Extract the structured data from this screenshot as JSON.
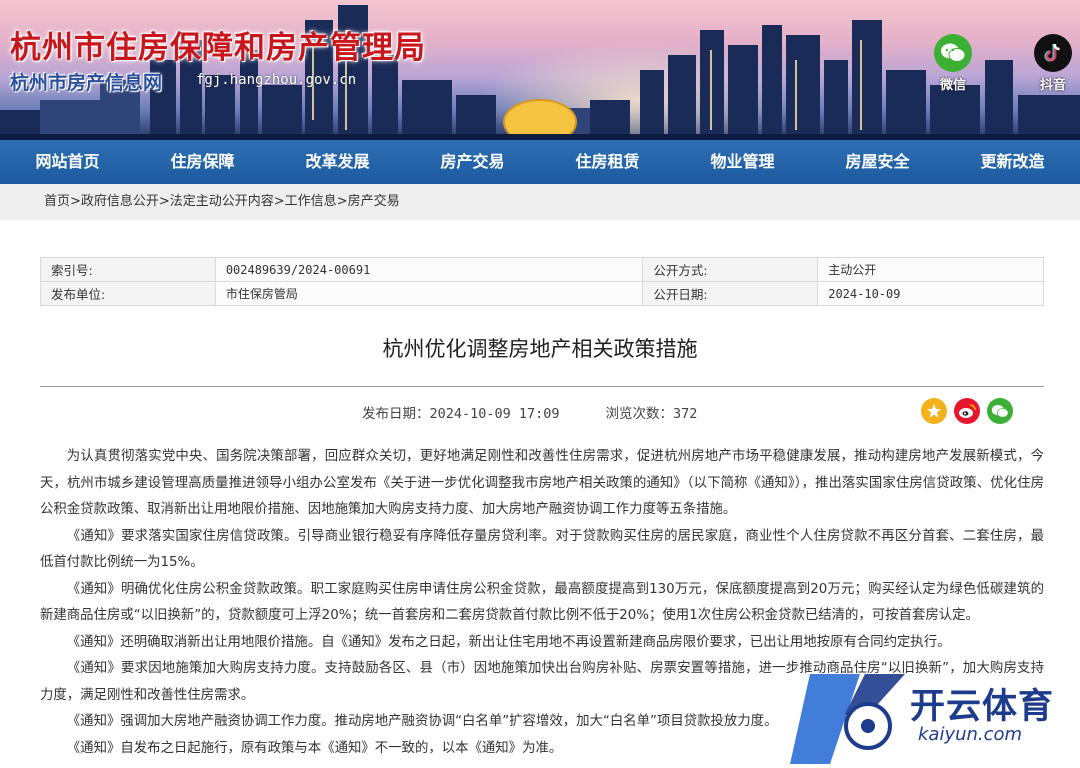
{
  "header": {
    "site_title": "杭州市住房保障和房产管理局",
    "sub_title": "杭州市房产信息网",
    "domain": "fgj.hangzhou.gov.cn",
    "wechat_label": "微信",
    "douyin_label": "抖音"
  },
  "nav": {
    "items": [
      "网站首页",
      "住房保障",
      "改革发展",
      "房产交易",
      "住房租赁",
      "物业管理",
      "房屋安全",
      "更新改造"
    ]
  },
  "breadcrumb": "首页>政府信息公开>法定主动公开内容>工作信息>房产交易",
  "info": {
    "index_label": "索引号:",
    "index_value": "002489639/2024-00691",
    "mode_label": "公开方式:",
    "mode_value": "主动公开",
    "issuer_label": "发布单位:",
    "issuer_value": "市住保房管局",
    "date_label": "公开日期:",
    "date_value": "2024-10-09"
  },
  "article": {
    "title": "杭州优化调整房地产相关政策措施",
    "publish_label": "发布日期：",
    "publish_value": "2024-10-09 17:09",
    "views_label": "浏览次数：",
    "views_value": "372",
    "paragraphs": [
      "为认真贯彻落实党中央、国务院决策部署，回应群众关切，更好地满足刚性和改善性住房需求，促进杭州房地产市场平稳健康发展，推动构建房地产发展新模式，今天，杭州市城乡建设管理高质量推进领导小组办公室发布《关于进一步优化调整我市房地产相关政策的通知》（以下简称《通知》），推出落实国家住房信贷政策、优化住房公积金贷款政策、取消新出让用地限价措施、因地施策加大购房支持力度、加大房地产融资协调工作力度等五条措施。",
      "《通知》要求落实国家住房信贷政策。引导商业银行稳妥有序降低存量房贷利率。对于贷款购买住房的居民家庭，商业性个人住房贷款不再区分首套、二套住房，最低首付款比例统一为15%。",
      "《通知》明确优化住房公积金贷款政策。职工家庭购买住房申请住房公积金贷款，最高额度提高到130万元，保底额度提高到20万元；购买经认定为绿色低碳建筑的新建商品住房或“以旧换新”的，贷款额度可上浮20%；统一首套房和二套房贷款首付款比例不低于20%；使用1次住房公积金贷款已结清的，可按首套房认定。",
      "《通知》还明确取消新出让用地限价措施。自《通知》发布之日起，新出让住宅用地不再设置新建商品房限价要求，已出让用地按原有合同约定执行。",
      "《通知》要求因地施策加大购房支持力度。支持鼓励各区、县（市）因地施策加快出台购房补贴、房票安置等措施，进一步推动商品住房“以旧换新”，加大购房支持力度，满足刚性和改善性住房需求。",
      "《通知》强调加大房地产融资协调工作力度。推动房地产融资协调“白名单”扩容增效，加大“白名单”项目贷款投放力度。",
      "《通知》自发布之日起施行，原有政策与本《通知》不一致的，以本《通知》为准。"
    ]
  },
  "watermark": {
    "name": "开云体育",
    "url": "kaiyun.com"
  },
  "colors": {
    "title_red": "#c8161d",
    "nav_blue": "#1d5aa0",
    "wechat_green": "#3cb034",
    "weibo_red": "#e6162d",
    "star_yellow": "#f2b21c"
  }
}
